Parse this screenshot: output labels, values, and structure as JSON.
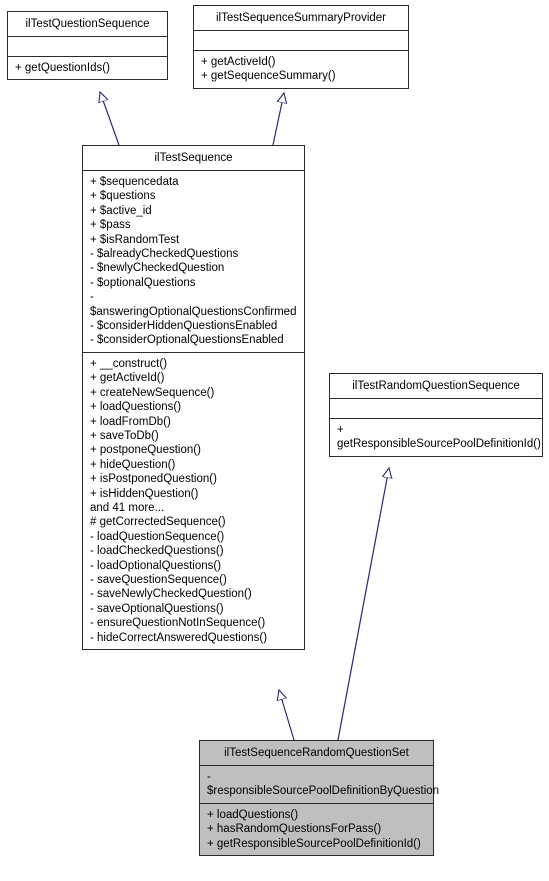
{
  "diagram": {
    "type": "uml-class-diagram",
    "background": "#ffffff",
    "edge_color": "#2a2a78",
    "border_color": "#2b2b2b",
    "highlight_fill": "#bfbfbf"
  },
  "classes": {
    "iltestquestionsequence": {
      "name": "ilTestQuestionSequence",
      "attributes": [],
      "methods": [
        "+ getQuestionIds()"
      ]
    },
    "iltestsequencesummaryprovider": {
      "name": "ilTestSequenceSummaryProvider",
      "attributes": [],
      "methods": [
        "+ getActiveId()",
        "+ getSequenceSummary()"
      ]
    },
    "iltestsequence": {
      "name": "ilTestSequence",
      "attributes": [
        "+ $sequencedata",
        "+ $questions",
        "+ $active_id",
        "+ $pass",
        "+ $isRandomTest",
        "- $alreadyCheckedQuestions",
        "- $newlyCheckedQuestion",
        "- $optionalQuestions",
        "- $answeringOptionalQuestionsConfirmed",
        "- $considerHiddenQuestionsEnabled",
        "- $considerOptionalQuestionsEnabled"
      ],
      "methods": [
        "+ __construct()",
        "+ getActiveId()",
        "+ createNewSequence()",
        "+ loadQuestions()",
        "+ loadFromDb()",
        "+ saveToDb()",
        "+ postponeQuestion()",
        "+ hideQuestion()",
        "+ isPostponedQuestion()",
        "+ isHiddenQuestion()",
        "and 41 more...",
        "# getCorrectedSequence()",
        "- loadQuestionSequence()",
        "- loadCheckedQuestions()",
        "- loadOptionalQuestions()",
        "- saveQuestionSequence()",
        "- saveNewlyCheckedQuestion()",
        "- saveOptionalQuestions()",
        "- ensureQuestionNotInSequence()",
        "- hideCorrectAnsweredQuestions()"
      ]
    },
    "iltestrandomquestionsequence": {
      "name": "ilTestRandomQuestionSequence",
      "attributes": [],
      "methods": [
        "+ getResponsibleSourcePoolDefinitionId()"
      ]
    },
    "iltestsequencerandomquestionset": {
      "name": "ilTestSequenceRandomQuestionSet",
      "attributes": [
        "- $responsibleSourcePoolDefinitionByQuestion"
      ],
      "methods": [
        "+ loadQuestions()",
        "+ hasRandomQuestionsForPass()",
        "+ getResponsibleSourcePoolDefinitionId()"
      ]
    }
  },
  "relations": [
    {
      "from": "iltestsequence",
      "to": "iltestquestionsequence",
      "kind": "generalization"
    },
    {
      "from": "iltestsequence",
      "to": "iltestsequencesummaryprovider",
      "kind": "generalization"
    },
    {
      "from": "iltestsequencerandomquestionset",
      "to": "iltestsequence",
      "kind": "generalization"
    },
    {
      "from": "iltestsequencerandomquestionset",
      "to": "iltestrandomquestionsequence",
      "kind": "generalization"
    }
  ]
}
